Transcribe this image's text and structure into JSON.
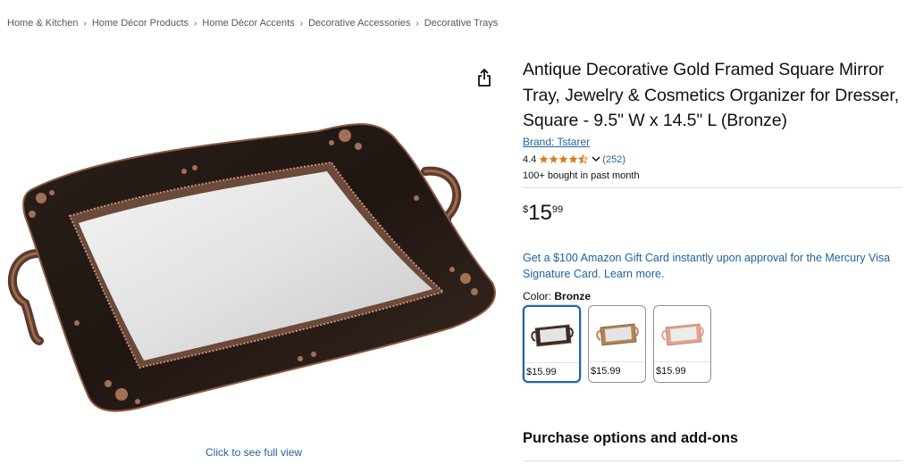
{
  "breadcrumb": [
    "Home & Kitchen",
    "Home Décor Products",
    "Home Décor Accents",
    "Decorative Accessories",
    "Decorative Trays"
  ],
  "breadcrumb_separator": "›",
  "image": {
    "full_view_text": "Click to see full view"
  },
  "product": {
    "title": "Antique Decorative Gold Framed Square Mirror Tray, Jewelry & Cosmetics Organizer for Dresser, Square - 9.5\" W x 14.5\" L (Bronze)",
    "brand": "Brand: Tstarer",
    "rating": "4.4",
    "stars_value": 4.4,
    "review_count": "(252)",
    "bought": "100+ bought in past month",
    "price": {
      "symbol": "$",
      "whole": "15",
      "fraction": "99"
    },
    "promo": "Get a $100 Amazon Gift Card instantly upon approval for the Mercury Visa Signature Card. Learn more.",
    "color_label": "Color:",
    "color_value": "Bronze",
    "swatches": [
      {
        "name": "Bronze",
        "price": "$15.99",
        "selected": true,
        "frame_color": "#3a2a22"
      },
      {
        "name": "Gold",
        "price": "$15.99",
        "selected": false,
        "frame_color": "#b08556"
      },
      {
        "name": "Rose",
        "price": "$15.99",
        "selected": false,
        "frame_color": "#e3a290"
      }
    ]
  },
  "purchase_options_title": "Purchase options and add-ons",
  "colors": {
    "link": "#2162a1",
    "star": "#de7921",
    "text": "#0f1111",
    "muted": "#565959"
  }
}
